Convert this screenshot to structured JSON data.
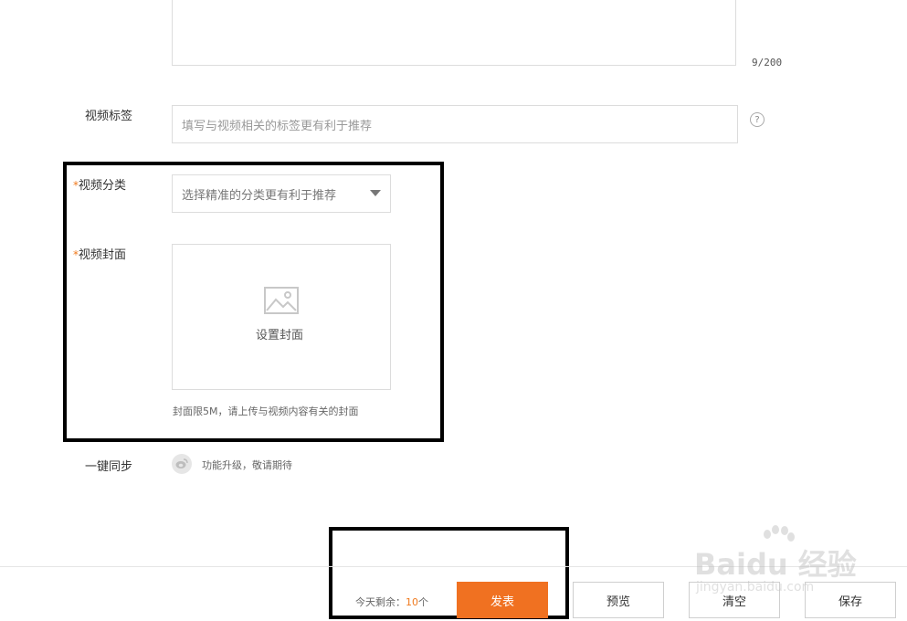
{
  "description": {
    "char_count": "9/200"
  },
  "tags": {
    "label": "视频标签",
    "placeholder": "填写与视频相关的标签更有利于推荐",
    "help_glyph": "?"
  },
  "category": {
    "required_mark": "*",
    "label": "视频分类",
    "placeholder": "选择精准的分类更有利于推荐"
  },
  "cover": {
    "required_mark": "*",
    "label": "视频封面",
    "set_cover": "设置封面",
    "hint": "封面限5M，请上传与视频内容有关的封面"
  },
  "sync": {
    "label": "一键同步",
    "note": "功能升级，敬请期待"
  },
  "footer": {
    "remain_prefix": "今天剩余：",
    "remain_count": "10",
    "remain_unit": "个",
    "publish": "发表",
    "preview": "预览",
    "clear": "清空",
    "save": "保存"
  },
  "watermark": {
    "brand": "Baidu 经验",
    "url": "jingyan.baidu.com"
  },
  "colors": {
    "accent": "#f07121",
    "required": "#f07a1e",
    "border": "#dcdcdc",
    "annotation": "#000000"
  }
}
